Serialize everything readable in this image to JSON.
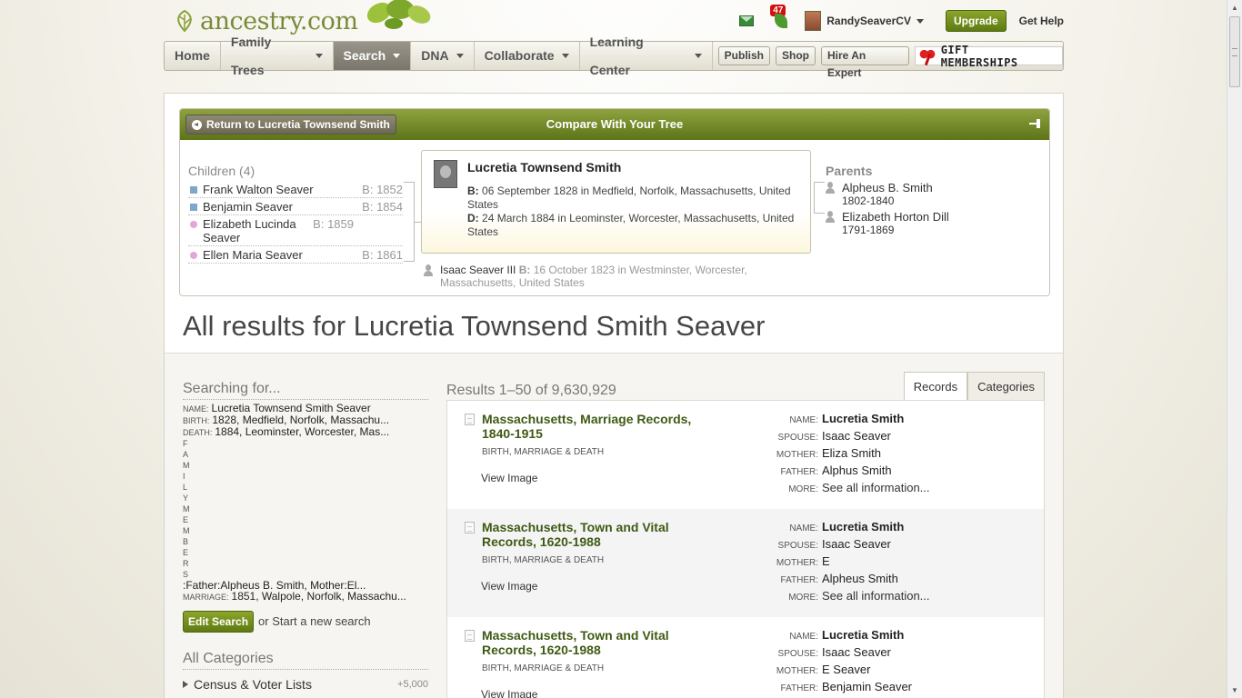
{
  "header": {
    "logo_text": "ancestry.com",
    "notification_count": "47",
    "username": "RandySeaverCV",
    "upgrade_label": "Upgrade",
    "get_help_label": "Get Help"
  },
  "nav": {
    "items": [
      {
        "label": "Home",
        "dropdown": false
      },
      {
        "label": "Family Trees",
        "dropdown": true
      },
      {
        "label": "Search",
        "dropdown": true,
        "active": true
      },
      {
        "label": "DNA",
        "dropdown": true
      },
      {
        "label": "Collaborate",
        "dropdown": true
      },
      {
        "label": "Learning Center",
        "dropdown": true
      }
    ],
    "pills": [
      "Publish",
      "Shop",
      "Hire An Expert"
    ],
    "gift_label": "GIFT MEMBERSHIPS"
  },
  "compare": {
    "return_label": "Return to Lucretia Townsend Smith",
    "title": "Compare With Your Tree",
    "children_header": "Children (4)",
    "children": [
      {
        "name": "Frank Walton Seaver",
        "birth": "B: 1852",
        "sex": "m"
      },
      {
        "name": "Benjamin Seaver",
        "birth": "B: 1854",
        "sex": "m"
      },
      {
        "name": "Elizabeth Lucinda Seaver",
        "birth": "B: 1859",
        "sex": "f"
      },
      {
        "name": "Ellen Maria Seaver",
        "birth": "B: 1861",
        "sex": "f"
      }
    ],
    "focus": {
      "name": "Lucretia Townsend Smith",
      "birth_label": "B:",
      "birth": "06 September 1828 in Medfield, Norfolk, Massachusetts, United States",
      "death_label": "D:",
      "death": "24 March 1884 in Leominster, Worcester, Massachusetts, United States"
    },
    "parents_header": "Parents",
    "parents": [
      {
        "name": "Alpheus B. Smith",
        "dates": "1802-1840"
      },
      {
        "name": "Elizabeth Horton Dill",
        "dates": "1791-1869"
      }
    ],
    "spouse": {
      "name": "Isaac Seaver III",
      "birth_label": "B:",
      "birth": "16 October 1823 in Westminster, Worcester, Massachusetts, United States"
    }
  },
  "page_title": "All results for Lucretia Townsend Smith Seaver",
  "searching_for": {
    "header": "Searching for...",
    "name_label": "NAME:",
    "name": "Lucretia Townsend Smith Seaver",
    "birth_label": "BIRTH:",
    "birth": "1828, Medfield, Norfolk, Massachu...",
    "death_label": "DEATH:",
    "death": "1884, Leominster, Worcester, Mas...",
    "family_letters": [
      "F",
      "A",
      "M",
      "I",
      "L",
      "Y",
      "M",
      "E",
      "M",
      "B",
      "E",
      "R",
      "S"
    ],
    "family_value": ":Father:Alpheus B. Smith, Mother:El...",
    "marriage_label": "MARRIAGE:",
    "marriage": "1851, Walpole, Norfolk, Massachu...",
    "edit_label": "Edit Search",
    "new_search_label": "or Start a new search"
  },
  "categories": {
    "header": "All Categories",
    "items": [
      {
        "label": "Census & Voter Lists",
        "count": "+5,000"
      }
    ]
  },
  "results": {
    "summary": "Results 1–50 of 9,630,929",
    "tabs": [
      "Records",
      "Categories"
    ],
    "records": [
      {
        "title": "Massachusetts, Marriage Records, 1840-1915",
        "category": "BIRTH, MARRIAGE & DEATH",
        "view": "View Image",
        "fields": [
          {
            "k": "NAME:",
            "v": "Lucretia Smith"
          },
          {
            "k": "SPOUSE:",
            "v": "Isaac Seaver"
          },
          {
            "k": "MOTHER:",
            "v": "Eliza Smith"
          },
          {
            "k": "FATHER:",
            "v": "Alphus Smith"
          },
          {
            "k": "MORE:",
            "v": "See all information..."
          }
        ]
      },
      {
        "title": "Massachusetts, Town and Vital Records, 1620-1988",
        "category": "BIRTH, MARRIAGE & DEATH",
        "view": "View Image",
        "fields": [
          {
            "k": "NAME:",
            "v": "Lucretia Smith"
          },
          {
            "k": "SPOUSE:",
            "v": "Isaac Seaver"
          },
          {
            "k": "MOTHER:",
            "v": "E"
          },
          {
            "k": "FATHER:",
            "v": "Alpheus Smith"
          },
          {
            "k": "MORE:",
            "v": "See all information..."
          }
        ]
      },
      {
        "title": "Massachusetts, Town and Vital Records, 1620-1988",
        "category": "BIRTH, MARRIAGE & DEATH",
        "view": "View Image",
        "fields": [
          {
            "k": "NAME:",
            "v": "Lucretia Smith"
          },
          {
            "k": "SPOUSE:",
            "v": "Isaac Seaver"
          },
          {
            "k": "MOTHER:",
            "v": "E Seaver"
          },
          {
            "k": "FATHER:",
            "v": "Benjamin Seaver"
          }
        ]
      }
    ]
  }
}
